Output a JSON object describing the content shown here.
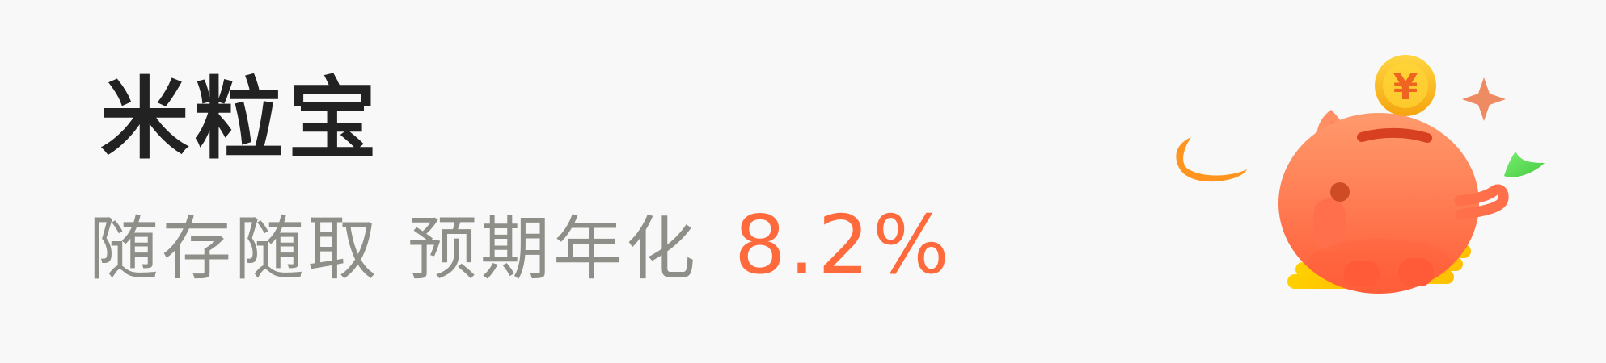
{
  "banner": {
    "title": "米粒宝",
    "subtitle": {
      "text_1": "随存随取",
      "text_2": "预期年化",
      "rate": "8.2%"
    },
    "icons": {
      "piggy_bank": "piggy-bank-icon",
      "coin": "yuan-coin-icon",
      "sparkle": "sparkle-icon",
      "coin_stack": "coin-stack-icon",
      "leaf": "leaf-icon"
    },
    "yuan_symbol": "¥"
  },
  "colors": {
    "background": "#f8f8f8",
    "title": "#222222",
    "subtitle": "#8f8f89",
    "accent": "#ff6a3d",
    "coin_gold": "#f7b71d",
    "pig_orange": "#ff7a56",
    "leaf_green": "#5edb55",
    "ribbon_orange": "#ff9a1f"
  }
}
